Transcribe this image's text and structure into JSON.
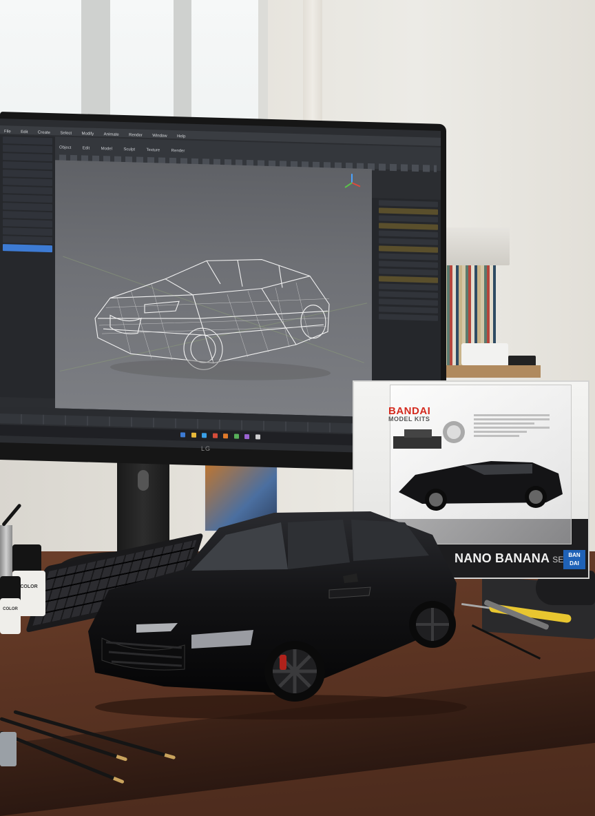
{
  "scene": {
    "description_tags": [
      "monitor-3d-wireframe-car",
      "scale-model-car",
      "model-kit-box",
      "hobby-desk"
    ]
  },
  "monitor": {
    "brand": "LG",
    "app": {
      "title": "",
      "menu": [
        "File",
        "Edit",
        "Create",
        "Select",
        "Modify",
        "Animate",
        "Render",
        "Window",
        "Help"
      ],
      "tool_tabs": [
        "Object",
        "Edit",
        "Model",
        "Sculpt",
        "Texture",
        "Render"
      ]
    }
  },
  "box": {
    "brand": "BANDAI",
    "subtitle": "MODEL KITS",
    "series_name": "NANO BANANA",
    "series_suffix": "SERIES",
    "logo_line1": "BAN",
    "logo_line2": "DAI"
  },
  "paint": {
    "bottle1_label": "COLOR",
    "bottle2_label": "COLOR"
  },
  "colors": {
    "car_body": "#141416",
    "wireframe": "#f2f2f2",
    "box_brand_red": "#d42a1e",
    "bandai_blue": "#1f62b7",
    "selection_blue": "#3d7bd4",
    "desk_wood": "#5a3322"
  }
}
